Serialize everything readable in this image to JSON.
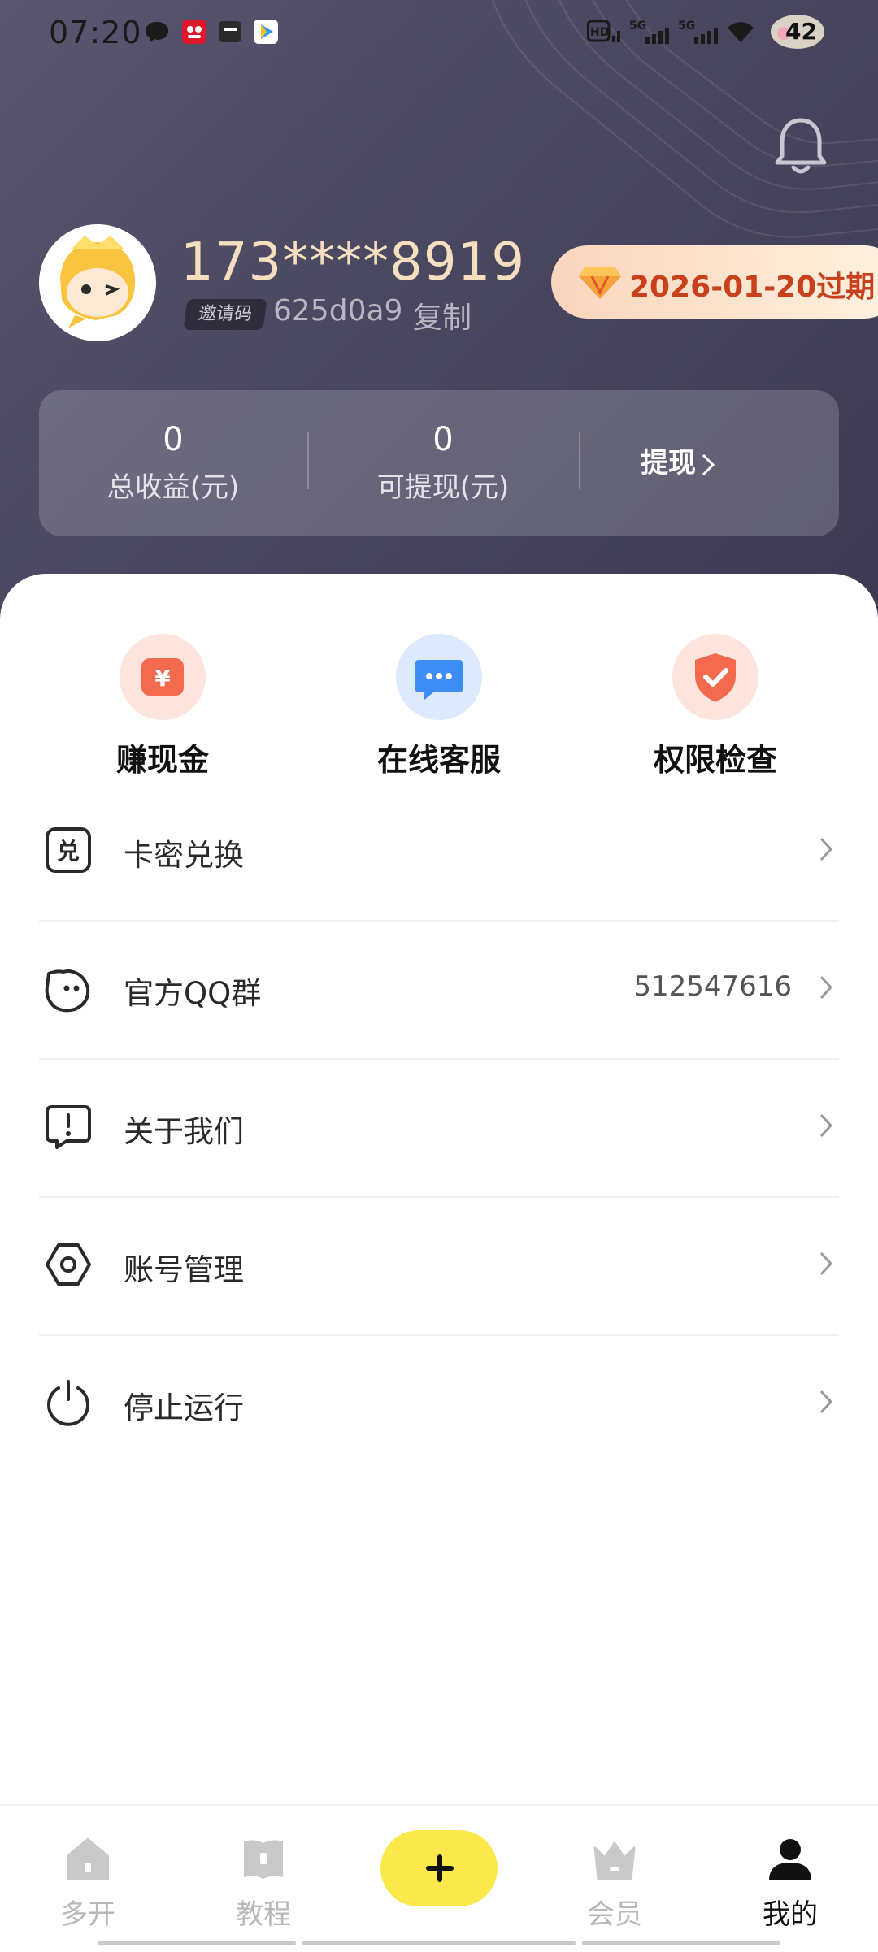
{
  "status_bar": {
    "time": "07:20",
    "battery": "42",
    "network": [
      "HD",
      "5G",
      "5G"
    ]
  },
  "profile": {
    "username": "173****8919",
    "invite_badge": "邀请码",
    "invite_code": "625d0a9",
    "copy_label": "复制",
    "vip_expiry": "2026-01-20过期"
  },
  "earnings": {
    "total": {
      "value": "0",
      "label": "总收益(元)"
    },
    "withdrawable": {
      "value": "0",
      "label": "可提现(元)"
    },
    "withdraw_label": "提现"
  },
  "quick_actions": [
    {
      "label": "赚现金",
      "icon": "yuan-icon"
    },
    {
      "label": "在线客服",
      "icon": "chat-icon"
    },
    {
      "label": "权限检查",
      "icon": "shield-check-icon"
    }
  ],
  "menu": [
    {
      "label": "卡密兑换",
      "value": "",
      "icon": "redeem-icon"
    },
    {
      "label": "官方QQ群",
      "value": "512547616",
      "icon": "qq-face-icon"
    },
    {
      "label": "关于我们",
      "value": "",
      "icon": "info-bubble-icon"
    },
    {
      "label": "账号管理",
      "value": "",
      "icon": "hex-settings-icon"
    },
    {
      "label": "停止运行",
      "value": "",
      "icon": "power-icon"
    }
  ],
  "redeem_glyph": "兑",
  "tabbar": [
    {
      "label": "多开",
      "icon": "home-icon",
      "active": false
    },
    {
      "label": "教程",
      "icon": "book-icon",
      "active": false
    },
    {
      "label": "",
      "icon": "plus-icon",
      "active": false
    },
    {
      "label": "会员",
      "icon": "crown-icon",
      "active": false
    },
    {
      "label": "我的",
      "icon": "person-icon",
      "active": true
    }
  ],
  "colors": {
    "header_bg": "#4a4760",
    "username": "#f6dfbf",
    "vip_text": "#c8401c",
    "fab": "#fbe84a",
    "quick_red": "#f46a4e",
    "quick_blue": "#3d8df5"
  }
}
